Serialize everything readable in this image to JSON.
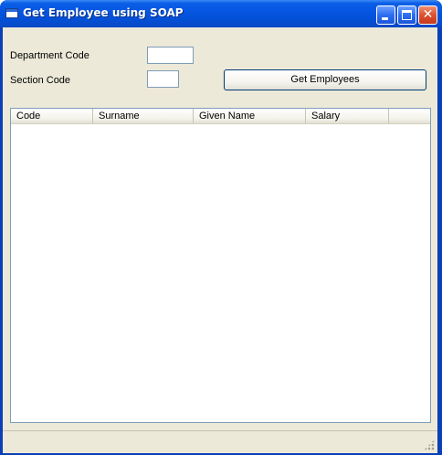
{
  "window": {
    "title": "Get Employee using SOAP"
  },
  "form": {
    "department_label": "Department Code",
    "department_value": "",
    "section_label": "Section Code",
    "section_value": "",
    "get_button_label": "Get Employees"
  },
  "listview": {
    "columns": [
      "Code",
      "Surname",
      "Given Name",
      "Salary"
    ],
    "rows": []
  },
  "colors": {
    "titlebar": "#0656e3",
    "client_bg": "#ece9d8",
    "close_button": "#dd5030"
  },
  "icons": {
    "window_icon": "window-app-icon",
    "minimize": "minimize-icon",
    "maximize": "maximize-icon",
    "close": "close-icon"
  }
}
